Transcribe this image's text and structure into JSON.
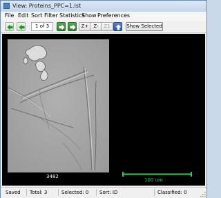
{
  "window": {
    "title": "View: Proteins_PPC=1.lst"
  },
  "menu": {
    "items": [
      "File",
      "Edit",
      "Sort",
      "Filter",
      "Statistics",
      "Show",
      "Preferences"
    ]
  },
  "toolbar": {
    "page_indicator": "1 of 3",
    "zoom_in_label": "Z+",
    "zoom_out_label": "Z-",
    "zoom_reset_label": "Z1",
    "show_selected_label": "Show Selected",
    "icons": [
      "arrow-left-icon",
      "arrow-left-icon",
      "arrow-right-icon",
      "arrow-right-icon",
      "arrow-up-icon"
    ]
  },
  "viewer": {
    "image_caption": "3482",
    "scale_bar_label": "100 um",
    "scale_bar_color": "#2fcf4e",
    "background_color": "#000000"
  },
  "status": {
    "state": "Saved",
    "total": "Total:  3",
    "selected": "Selected:  0",
    "sort": "Sort: ID",
    "classified": "Classified:  0"
  }
}
